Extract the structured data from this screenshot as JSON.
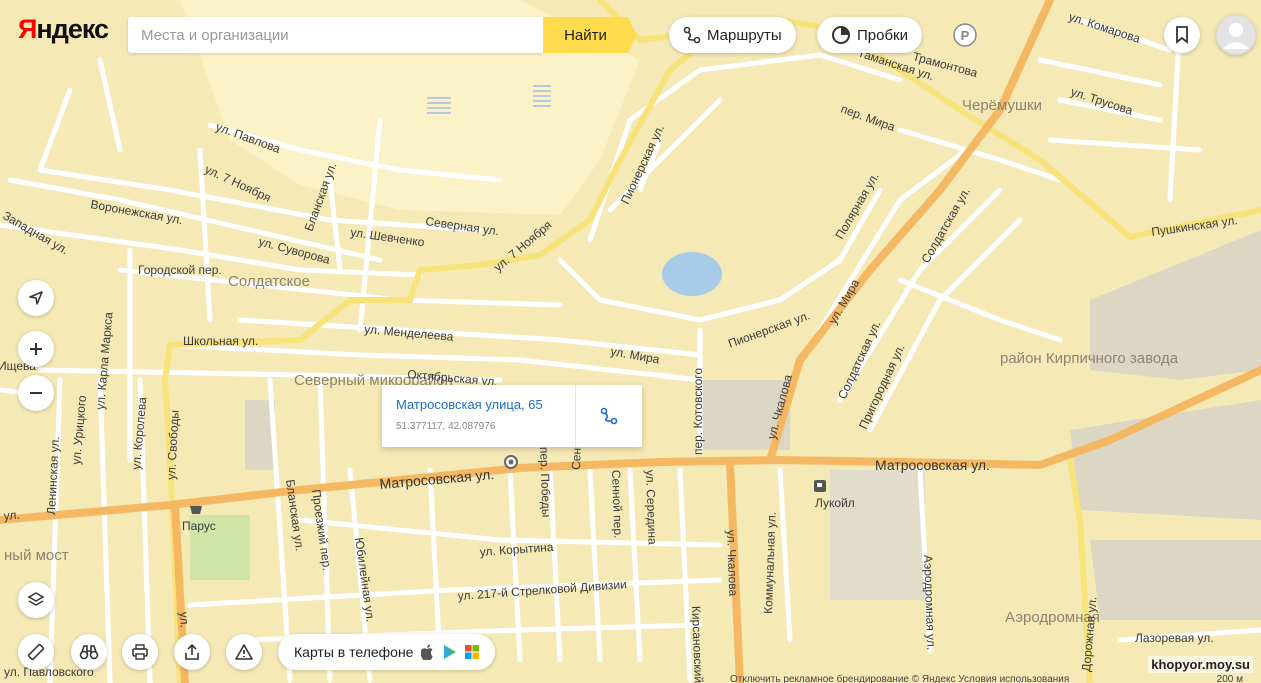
{
  "header": {
    "logo_first": "Я",
    "logo_rest": "ндекс",
    "search_placeholder": "Места и организации",
    "search_button": "Найти",
    "routes_label": "Маршруты",
    "traffic_label": "Пробки",
    "parking_letter": "P"
  },
  "popup": {
    "title": "Матросовская улица, 65",
    "coords": "51.377117, 42.087976"
  },
  "bottom": {
    "mobile_label": "Карты в телефоне"
  },
  "footer": {
    "copyright": "Отключить рекламное брендирование   © Яндекс Условия использования",
    "watermark": "khopyor.moy.su",
    "scale": "200 м"
  },
  "map": {
    "districts": [
      "Солдатское",
      "Северный микрорайон",
      "Черёмушки",
      "район Кирпичного завода",
      "Аэродромная",
      "ный мост"
    ],
    "streets": [
      "Матросовская ул.",
      "ул. 7 Ноября",
      "ул. Мира",
      "Пионерская ул.",
      "ул. Чкалова",
      "Пушкинская ул.",
      "Школьная ул.",
      "ул. Менделеева",
      "Октябрьская ул.",
      "ул. Мира",
      "Северная ул.",
      "ул. Шевченко",
      "ул. Суворова",
      "Городской пер.",
      "ул. Павлова",
      "ул. 7 Ноября",
      "Воронежская ул.",
      "Западная ул.",
      "Бланская ул.",
      "ул. Карла Маркса",
      "ул. Урицкого",
      "ул. Королева",
      "ул. Свободы",
      "Ленинская ул.",
      "Бланская ул.",
      "Проезжий пер.",
      "Юбилейная ул.",
      "ул. Корытина",
      "ул. 217-й Стрелковой Дивизии",
      "пер. Победы",
      "Сенная ул.",
      "Сенной пер.",
      "ул. Середина",
      "ул. Чкалова",
      "Кирсановский",
      "Коммунальная ул.",
      "Аэродромная ул.",
      "Дорожная ул.",
      "Лазоревая ул.",
      "пер. Котовского",
      "Пионерская ул.",
      "Полярная ул.",
      "Солдатская ул.",
      "Солдатская ул.",
      "Пригородная ул.",
      "пер. Мира",
      "ул. Трусова",
      "ул. Комарова",
      "ул. Павловского",
      "Лукойл",
      "Парус",
      "ул.",
      "ул.",
      "Ищева",
      "Трамонтова",
      "Таманская ул."
    ]
  },
  "colors": {
    "map_bg": "#f5e9b6",
    "major_road": "#f5b862",
    "yellow_road": "#f8e27a",
    "minor_road": "#ffffff",
    "water": "#a8cce8",
    "park": "#cfe4a6",
    "industrial": "#dcd6c4",
    "accent": "#ffdb4d",
    "link": "#1a6ec9"
  }
}
